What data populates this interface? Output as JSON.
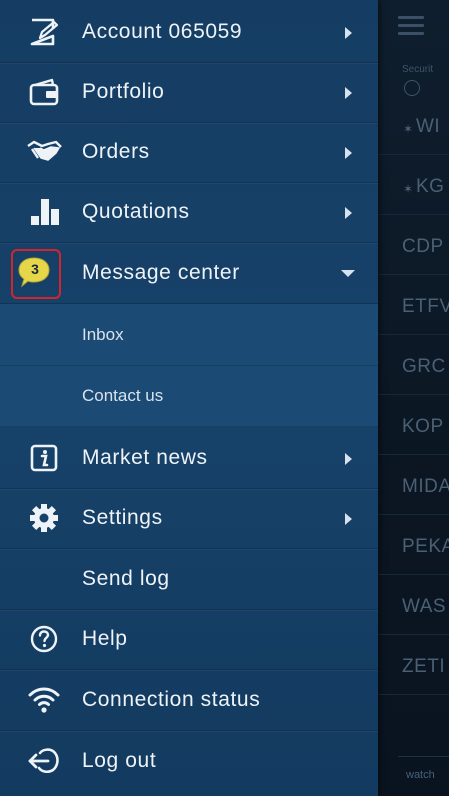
{
  "background": {
    "securities_label": "Securit",
    "rows": [
      {
        "text": "WI",
        "starred": true
      },
      {
        "text": "KG",
        "starred": true
      },
      {
        "text": "CDP",
        "starred": false
      },
      {
        "text": "ETFV",
        "starred": false
      },
      {
        "text": "GRC",
        "starred": false
      },
      {
        "text": "KOP",
        "starred": false
      },
      {
        "text": "MIDA",
        "starred": false
      },
      {
        "text": "PEKA",
        "starred": false
      },
      {
        "text": "WAS",
        "starred": false
      },
      {
        "text": "ZETI",
        "starred": false
      }
    ],
    "bottom_tab": "watch"
  },
  "menu": {
    "account": "Account 065059",
    "portfolio": "Portfolio",
    "orders": "Orders",
    "quotations": "Quotations",
    "message_center": "Message center",
    "message_badge": "3",
    "inbox": "Inbox",
    "contact_us": "Contact us",
    "market_news": "Market news",
    "settings": "Settings",
    "send_log": "Send log",
    "help": "Help",
    "connection_status": "Connection status",
    "log_out": "Log out"
  },
  "colors": {
    "drawer_bg": "#174269",
    "submenu_bg": "#1b4a74",
    "badge_yellow": "#e6d64a",
    "highlight_red": "#d3252e"
  }
}
